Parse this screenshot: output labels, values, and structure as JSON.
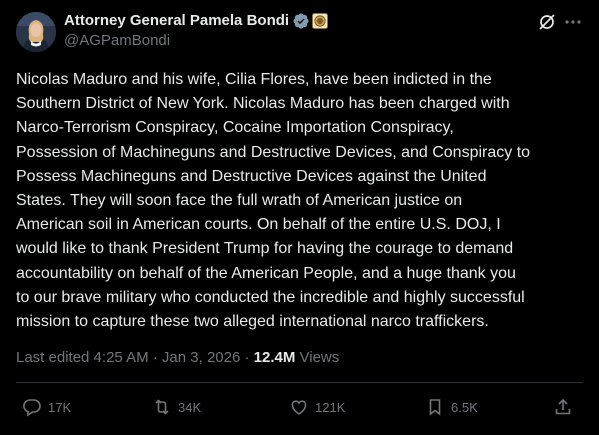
{
  "author": {
    "display_name": "Attorney General Pamela Bondi",
    "handle": "@AGPamBondi",
    "verified_color": "#829aab"
  },
  "post": {
    "text": "Nicolas Maduro and his wife, Cilia Flores, have been indicted in the\nSouthern District of New York.  Nicolas Maduro has been charged with\nNarco-Terrorism Conspiracy, Cocaine Importation Conspiracy,\nPossession of Machineguns and Destructive Devices, and Conspiracy to\nPossess Machineguns and Destructive Devices against the United\nStates.  They will soon face the full wrath of American justice on\nAmerican soil in American courts. On behalf of the entire U.S. DOJ, I\nwould like to thank President Trump for having the courage to demand\naccountability on behalf of the American People, and a huge thank you\nto our brave military who conducted the incredible and highly successful\nmission to capture these two alleged international narco traffickers.",
    "edited_label": "Last edited 4:25 AM · Jan 3, 2026 · ",
    "views_count": "12.4M",
    "views_label": " Views"
  },
  "actions": {
    "replies": "17K",
    "reposts": "34K",
    "likes": "121K",
    "bookmarks": "6.5K"
  },
  "icons": {
    "grok": "grok-icon",
    "more": "more-icon",
    "reply": "reply-icon",
    "repost": "repost-icon",
    "like": "heart-icon",
    "bookmark": "bookmark-icon",
    "share": "share-icon"
  }
}
